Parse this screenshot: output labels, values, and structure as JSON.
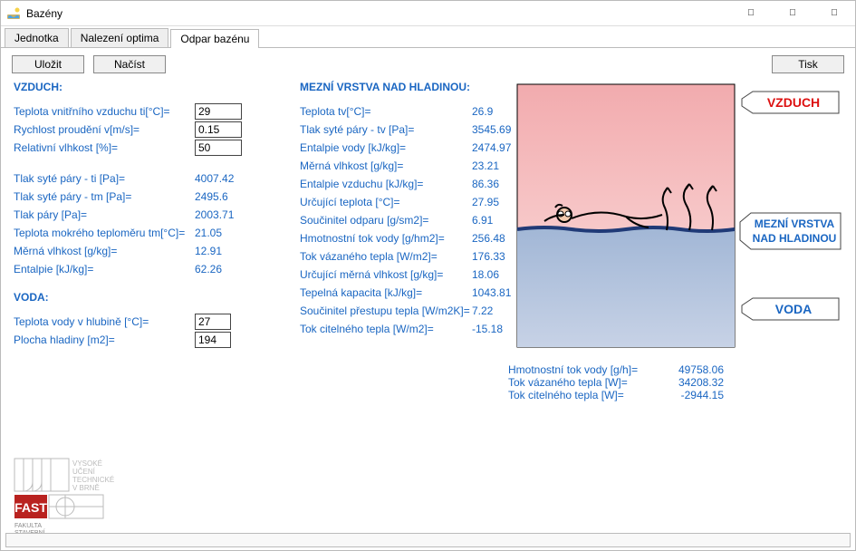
{
  "window": {
    "title": "Bazény"
  },
  "tabs": {
    "t1": "Jednotka",
    "t2": "Nalezení optima",
    "t3": "Odpar bazénu"
  },
  "buttons": {
    "save": "Uložit",
    "load": "Načíst",
    "print": "Tisk"
  },
  "air": {
    "header": "VZDUCH:",
    "in": [
      {
        "label": "Teplota vnitřního vzduchu ti[°C]=",
        "value": "29"
      },
      {
        "label": "Rychlost proudění v[m/s]=",
        "value": "0.15"
      },
      {
        "label": "Relativní vlhkost [%]=",
        "value": "50"
      }
    ],
    "out": [
      {
        "label": "Tlak syté páry - ti [Pa]=",
        "value": "4007.42"
      },
      {
        "label": "Tlak syté páry - tm [Pa]=",
        "value": "2495.6"
      },
      {
        "label": "Tlak páry [Pa]=",
        "value": "2003.71"
      },
      {
        "label": "Teplota mokrého teploměru tm[°C]=",
        "value": "21.05"
      },
      {
        "label": "Měrná vlhkost [g/kg]=",
        "value": "12.91"
      },
      {
        "label": "Entalpie [kJ/kg]=",
        "value": "62.26"
      }
    ]
  },
  "water": {
    "header": "VODA:",
    "in": [
      {
        "label": "Teplota vody v hlubině [°C]=",
        "value": "27"
      },
      {
        "label": "Plocha hladiny [m2]=",
        "value": "194"
      }
    ]
  },
  "boundary": {
    "header": "MEZNÍ VRSTVA NAD HLADINOU:",
    "rows": [
      {
        "label": "Teplota tv[°C]=",
        "value": "26.9"
      },
      {
        "label": "Tlak syté páry - tv [Pa]=",
        "value": "3545.69"
      },
      {
        "label": "Entalpie vody [kJ/kg]=",
        "value": "2474.97"
      },
      {
        "label": "Měrná vlhkost [g/kg]=",
        "value": "23.21"
      },
      {
        "label": "Entalpie vzduchu [kJ/kg]=",
        "value": "86.36"
      },
      {
        "label": "Určující teplota [°C]=",
        "value": "27.95"
      },
      {
        "label": "Součinitel odparu [g/sm2]=",
        "value": "6.91"
      },
      {
        "label": "Hmotnostní tok vody [g/hm2]=",
        "value": "256.48"
      },
      {
        "label": "Tok vázaného tepla [W/m2]=",
        "value": "176.33"
      },
      {
        "label": "Určující měrná vlhkost [g/kg]=",
        "value": "18.06"
      },
      {
        "label": "Tepelná kapacita [kJ/kg]=",
        "value": "1043.81"
      },
      {
        "label": "Součinitel přestupu tepla [W/m2K]=",
        "value": "7.22"
      },
      {
        "label": "Tok citelného tepla [W/m2]=",
        "value": "-15.18"
      }
    ]
  },
  "results": [
    {
      "label": "Hmotnostní tok vody [g/h]=",
      "value": "49758.06"
    },
    {
      "label": "Tok vázaného tepla [W]=",
      "value": "34208.32"
    },
    {
      "label": "Tok citelného tepla [W]=",
      "value": "-2944.15"
    }
  ],
  "diagram": {
    "label_air": "VZDUCH",
    "label_boundary1": "MEZNÍ VRSTVA",
    "label_boundary2": "NAD HLADINOU",
    "label_water": "VODA"
  },
  "logo": {
    "line1": "VYSOKÉ",
    "line2": "UČENÍ",
    "line3": "TECHNICKÉ",
    "line4": "V BRNĚ",
    "fast": "FAST",
    "fac1": "FAKULTA",
    "fac2": "STAVEBNÍ"
  }
}
